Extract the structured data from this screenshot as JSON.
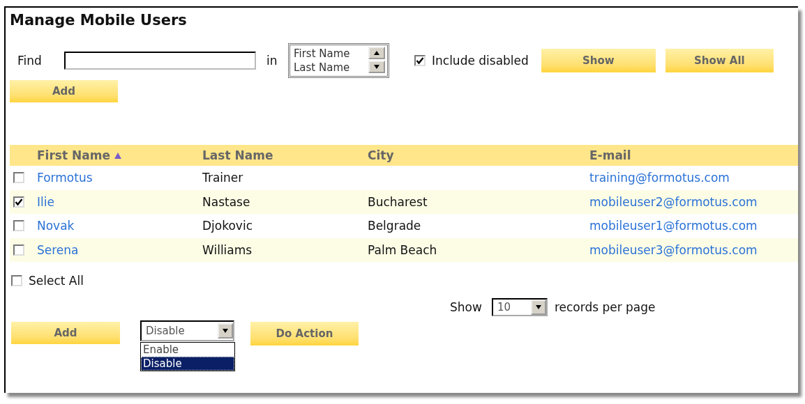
{
  "title": "Manage Mobile Users",
  "search": {
    "label": "Find",
    "in_label": "in",
    "fields": [
      {
        "label": "First Name"
      },
      {
        "label": "Last Name"
      }
    ]
  },
  "include_disabled": {
    "label": "Include disabled",
    "checked": true
  },
  "search_buttons": [
    "Show",
    "Show All"
  ],
  "add_button": "Add",
  "table": {
    "columns": [
      {
        "label": "First Name",
        "sorted_ascending": true
      },
      {
        "label": "Last Name",
        "sorted_ascending": false
      },
      {
        "label": "City",
        "sorted_ascending": false
      },
      {
        "label": "E-mail",
        "sorted_ascending": false
      }
    ],
    "rows": [
      {
        "checked": false,
        "first_name": "Formotus",
        "last_name": "Trainer",
        "email": "training@formotus.com"
      },
      {
        "checked": true,
        "first_name": "Ilie",
        "last_name": "Nastase",
        "city": "Bucharest",
        "email": "mobileuser2@formotus.com"
      },
      {
        "checked": false,
        "first_name": "Novak",
        "last_name": "Djokovic",
        "city": "Belgrade",
        "email": "mobileuser1@formotus.com"
      },
      {
        "checked": false,
        "first_name": "Serena",
        "last_name": "Williams",
        "city": "Palm Beach",
        "email": "mobileuser3@formotus.com"
      }
    ]
  },
  "select_all": {
    "label": "Select All",
    "checked": false
  },
  "paging": {
    "label_before": "Show",
    "value": "10",
    "label_after": "records per page"
  },
  "bottom": {
    "add_button": "Add",
    "action_select": {
      "value": "Disable",
      "expanded": true,
      "options": [
        {
          "label": "Enable",
          "selected": false
        },
        {
          "label": "Disable",
          "selected": true
        }
      ]
    },
    "do_action_button": "Do Action"
  }
}
